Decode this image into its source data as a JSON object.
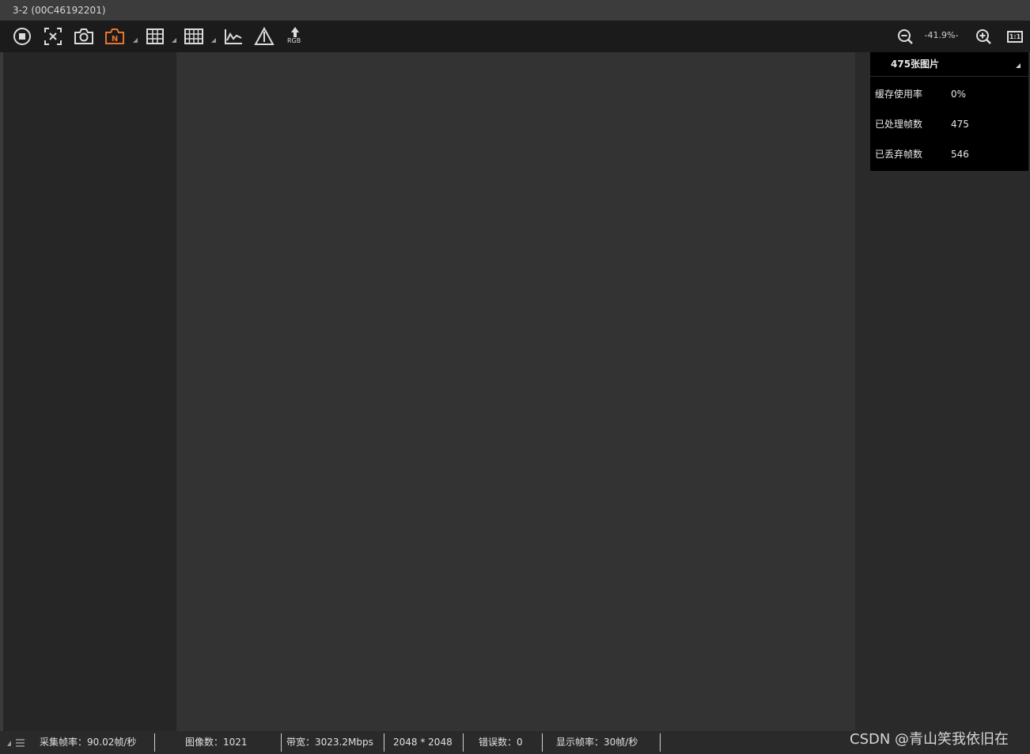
{
  "window": {
    "title": "3-2 (00C46192201)"
  },
  "toolbar": {
    "buttons": [
      {
        "name": "stop-button",
        "icon": "stop-circle-icon"
      },
      {
        "name": "fit-screen-button",
        "icon": "fit-screen-icon"
      },
      {
        "name": "snapshot-button",
        "icon": "camera-icon"
      },
      {
        "name": "record-button",
        "icon": "camera-n-icon",
        "color": "#e8742b"
      },
      {
        "name": "cross-line-button",
        "icon": "grid-icon"
      },
      {
        "name": "grid-button",
        "icon": "table-grid-icon"
      },
      {
        "name": "histogram-button",
        "icon": "line-chart-icon"
      },
      {
        "name": "warning-button",
        "icon": "warning-triangle-icon"
      },
      {
        "name": "rgb-button",
        "icon": "rgb-arrow-icon",
        "label": "RGB"
      }
    ],
    "zoom_level": "-41.9%-",
    "zoom_out_icon": "zoom-out-icon",
    "zoom_in_icon": "zoom-in-icon",
    "actual_size_label": "1:1"
  },
  "stats_panel": {
    "header": "475张图片",
    "rows": [
      {
        "label": "缓存使用率",
        "value": "0%"
      },
      {
        "label": "已处理帧数",
        "value": "475"
      },
      {
        "label": "已丢弃帧数",
        "value": "546"
      }
    ]
  },
  "statusbar": {
    "icon": "list-icon",
    "capture_fps": "采集帧率：90.02帧/秒",
    "image_count": "图像数：1021",
    "bandwidth": "带宽：3023.2Mbps",
    "resolution": "2048 * 2048",
    "error_count": "错误数：0",
    "display_fps": "显示帧率：30帧/秒"
  },
  "watermark": "CSDN @青山笑我依旧在",
  "colors": {
    "accent_orange": "#e8742b",
    "toolbar_bg": "#1b1b1b",
    "canvas_bg": "#333333"
  }
}
